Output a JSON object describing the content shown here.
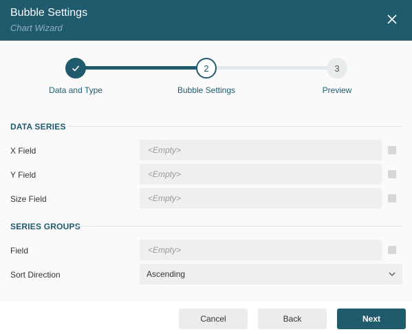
{
  "header": {
    "title": "Bubble Settings",
    "subtitle": "Chart Wizard",
    "close_icon": "close-icon"
  },
  "steps": [
    {
      "number": "",
      "label": "Data and Type",
      "state": "completed",
      "icon": "checkmark-icon"
    },
    {
      "number": "2",
      "label": "Bubble Settings",
      "state": "active"
    },
    {
      "number": "3",
      "label": "Preview",
      "state": "pending"
    }
  ],
  "data_series": {
    "heading": "DATA SERIES",
    "fields": [
      {
        "label": "X Field",
        "placeholder": "<Empty>"
      },
      {
        "label": "Y Field",
        "placeholder": "<Empty>"
      },
      {
        "label": "Size Field",
        "placeholder": "<Empty>"
      }
    ]
  },
  "series_groups": {
    "heading": "SERIES GROUPS",
    "field": {
      "label": "Field",
      "placeholder": "<Empty>"
    },
    "sort_direction": {
      "label": "Sort Direction",
      "value": "Ascending",
      "icon": "chevron-down-icon"
    }
  },
  "footer": {
    "cancel": "Cancel",
    "back": "Back",
    "next": "Next"
  },
  "colors": {
    "accent": "#1f5a6d",
    "track_inactive": "#e4e8ea",
    "field_bg": "#efefef"
  }
}
